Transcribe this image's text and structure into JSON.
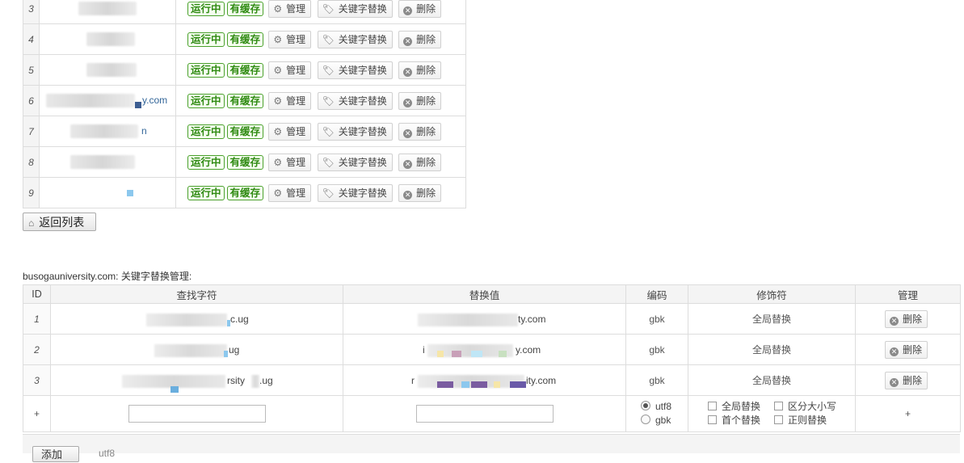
{
  "sites": {
    "badges": {
      "running": "运行中",
      "cached": "有缓存"
    },
    "buttons": {
      "manage": "管理",
      "keyword_replace": "关键字替换",
      "delete": "删除"
    },
    "rows": [
      {
        "num": "3",
        "host_suffix": ""
      },
      {
        "num": "4",
        "host_suffix": ""
      },
      {
        "num": "5",
        "host_suffix": ""
      },
      {
        "num": "6",
        "host_suffix": "y.com"
      },
      {
        "num": "7",
        "host_suffix": "n"
      },
      {
        "num": "8",
        "host_suffix": ""
      },
      {
        "num": "9",
        "host_suffix": ""
      }
    ]
  },
  "back_button": "返回列表",
  "keyword_section": {
    "title": "busogauniversity.com: 关键字替换管理:",
    "headers": [
      "ID",
      "查找字符",
      "替换值",
      "编码",
      "修饰符",
      "管理"
    ],
    "rows": [
      {
        "id": "1",
        "find": "c.ug",
        "replace": "ty.com",
        "encoding": "gbk",
        "modifier": "全局替换",
        "action": "删除"
      },
      {
        "id": "2",
        "find": "ug",
        "replace_prefix": "i",
        "replace": "y.com",
        "encoding": "gbk",
        "modifier": "全局替换",
        "action": "删除"
      },
      {
        "id": "3",
        "find": "rsity",
        "find_tail": ".ug",
        "replace_prefix": "r",
        "replace": "ity.com",
        "encoding": "gbk",
        "modifier": "全局替换",
        "action": "删除"
      }
    ],
    "add_row": {
      "plus": "+",
      "encoding_options": [
        "utf8",
        "gbk"
      ],
      "selected_encoding": "utf8",
      "modifier_options": [
        "全局替换",
        "区分大小写",
        "首个替换",
        "正则替换"
      ],
      "manage_plus": "+"
    }
  },
  "footer": {
    "add_button": "添加",
    "note": "utf8"
  }
}
